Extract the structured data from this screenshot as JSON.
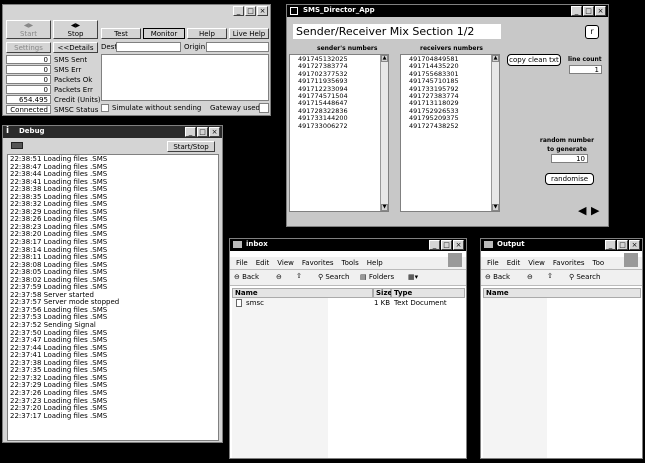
{
  "sms_window": {
    "start_label": "Start",
    "stop_label": "Stop",
    "settings_label": "Settings",
    "details_label": "<<Details",
    "test_label": "Test",
    "monitor_label": "Monitor",
    "help_label": "Help",
    "live_help_label": "Live Help",
    "dest_label": "Dest.",
    "origin_label": "Origin",
    "stats": [
      {
        "value": "0",
        "label": "SMS Sent"
      },
      {
        "value": "0",
        "label": "SMS Err"
      },
      {
        "value": "0",
        "label": "Packets Ok"
      },
      {
        "value": "0",
        "label": "Packets Err"
      },
      {
        "value": "654.495",
        "label": "Credit (Units)"
      },
      {
        "value": "Connected",
        "label": "SMSC Status"
      }
    ],
    "simulate_label": "Simulate without sending",
    "gateway_label": "Gateway used"
  },
  "director": {
    "window_title": "SMS_Director_App",
    "heading": "Sender/Receiver Mix Section 1/2",
    "r_button": "r",
    "senders_header": "sender's numbers",
    "receivers_header": "receivers numbers",
    "senders": [
      "491745132025",
      "491727383774",
      "491702377532",
      "491711935693",
      "491712233094",
      "491774571504",
      "491715448647",
      "491728322836",
      "491733144200",
      "491733006272"
    ],
    "receivers": [
      "491704849581",
      "491714435220",
      "491755683301",
      "491745710185",
      "491733195792",
      "491727383774",
      "491713118029",
      "491752926533",
      "491795209375",
      "491727438252"
    ],
    "copy_button": "copy clean txt",
    "line_count_label": "line count",
    "line_count_value": "1",
    "random_label": "random number to generate",
    "random_value": "10",
    "randomise_button": "randomise",
    "prev_arrow": "◀",
    "next_arrow": "▶"
  },
  "debug": {
    "window_title": "Debug",
    "start_stop_label": "Start/Stop",
    "lines": [
      "22:38:51 Loading files .SMS",
      "22:38:47 Loading files .SMS",
      "22:38:44 Loading files .SMS",
      "22:38:41 Loading files .SMS",
      "22:38:38 Loading files .SMS",
      "22:38:35 Loading files .SMS",
      "22:38:32 Loading files .SMS",
      "22:38:29 Loading files .SMS",
      "22:38:26 Loading files .SMS",
      "22:38:23 Loading files .SMS",
      "22:38:20 Loading files .SMS",
      "22:38:17 Loading files .SMS",
      "22:38:14 Loading files .SMS",
      "22:38:11 Loading files .SMS",
      "22:38:08 Loading files .SMS",
      "22:38:05 Loading files .SMS",
      "22:38:02 Loading files .SMS",
      "22:37:59 Loading files .SMS",
      "22:37:58 Server started",
      "22:37:57 Server mode stopped",
      "22:37:56 Loading files .SMS",
      "22:37:53 Loading files .SMS",
      "22:37:52 Sending Signal",
      "22:37:50 Loading files .SMS",
      "22:37:47 Loading files .SMS",
      "22:37:44 Loading files .SMS",
      "22:37:41 Loading files .SMS",
      "22:37:38 Loading files .SMS",
      "22:37:35 Loading files .SMS",
      "22:37:32 Loading files .SMS",
      "22:37:29 Loading files .SMS",
      "22:37:26 Loading files .SMS",
      "22:37:23 Loading files .SMS",
      "22:37:20 Loading files .SMS",
      "22:37:17 Loading files .SMS"
    ]
  },
  "inbox": {
    "window_title": "inbox",
    "menu": [
      "File",
      "Edit",
      "View",
      "Favorites",
      "Tools",
      "Help"
    ],
    "back_label": "Back",
    "search_label": "Search",
    "folders_label": "Folders",
    "col_name": "Name",
    "col_size": "Size",
    "col_type": "Type",
    "files": [
      {
        "name": "smsc",
        "size": "1 KB",
        "type": "Text Document"
      }
    ]
  },
  "output": {
    "window_title": "Output",
    "menu": [
      "File",
      "Edit",
      "View",
      "Favorites",
      "Too"
    ],
    "back_label": "Back",
    "search_label": "Search",
    "col_name": "Name"
  }
}
